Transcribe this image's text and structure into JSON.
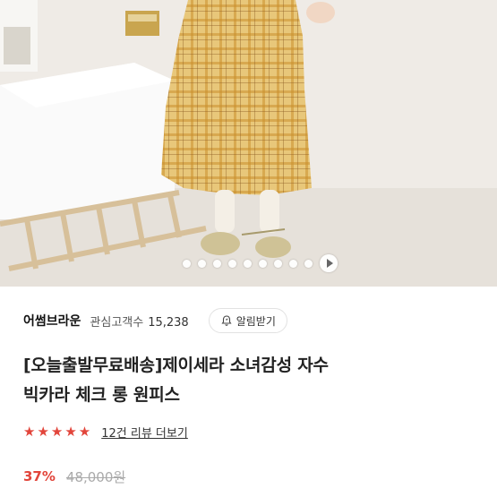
{
  "carousel": {
    "total_slides": 9,
    "current_slide": 1,
    "play_icon": "play-icon"
  },
  "seller": {
    "name": "어썸브라운",
    "follower_label": "관심고객수",
    "follower_count": "15,238",
    "alert_label": "알림받기",
    "alert_icon": "bell-icon"
  },
  "product": {
    "title_line1": "[오늘출발무료배송]제이세라 소녀감성 자수",
    "title_line2": "빅카라 체크 롱 원피스"
  },
  "review": {
    "rating": 5,
    "stars": "★★★★★",
    "link_label": "12건 리뷰 더보기"
  },
  "price": {
    "discount": "37%",
    "original": "48,000원"
  },
  "colors": {
    "accent_red": "#e2453b",
    "plaid_yellow": "#d9b25c"
  }
}
